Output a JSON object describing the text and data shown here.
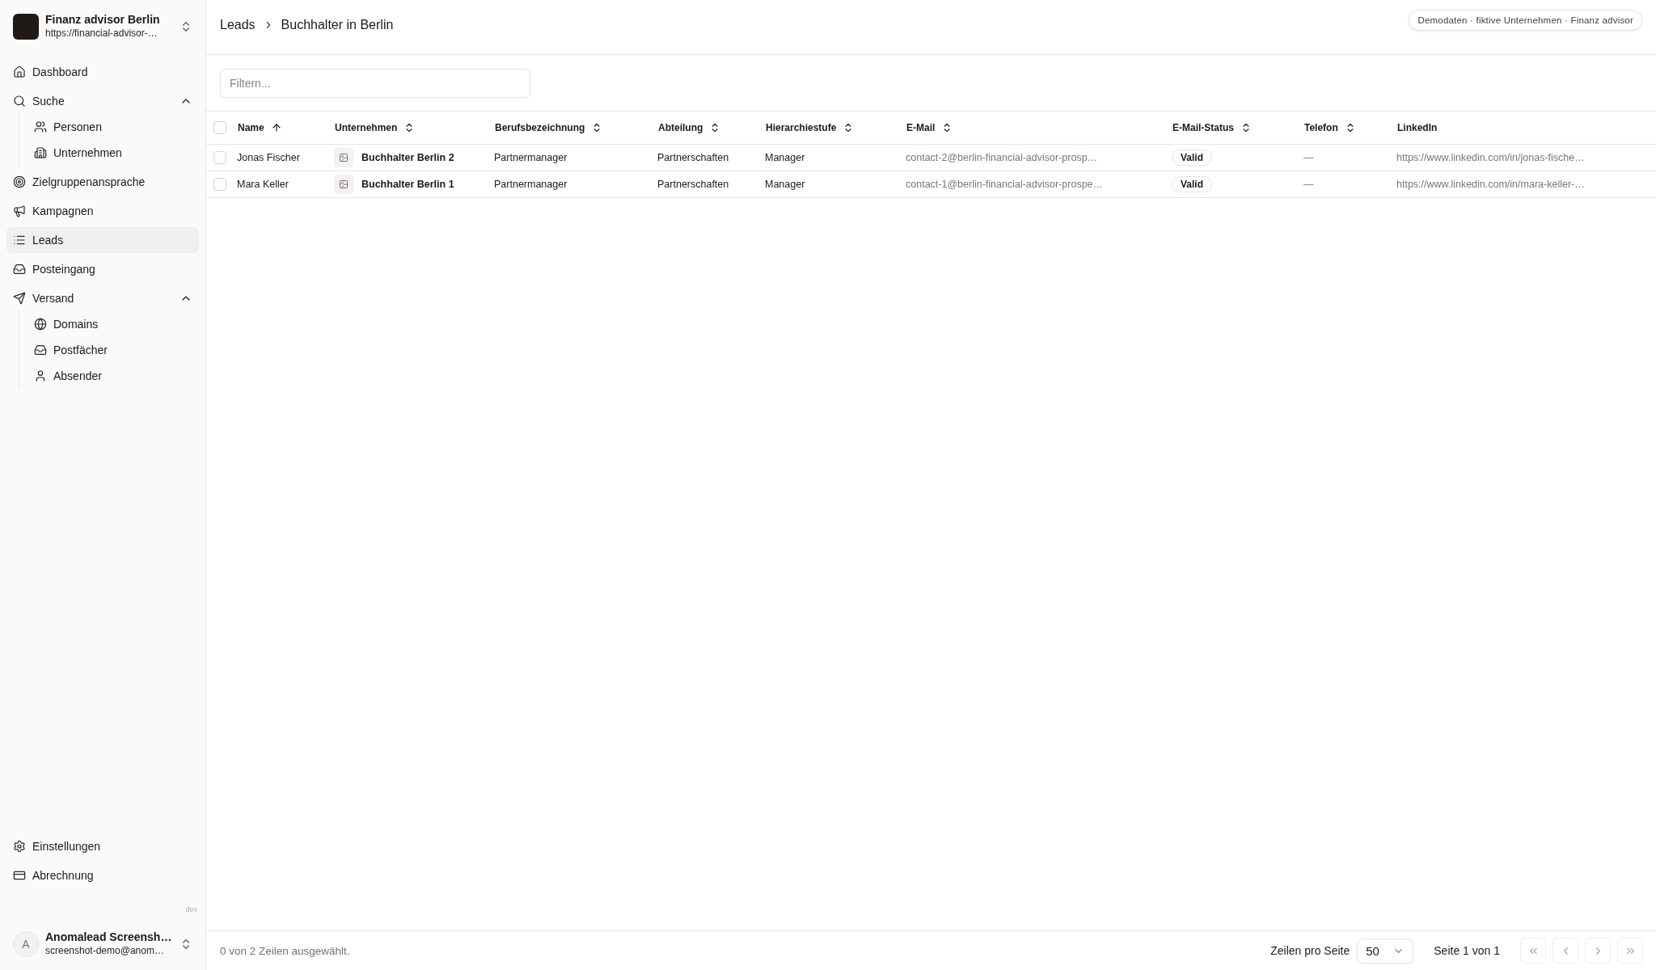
{
  "sidebar": {
    "workspace": {
      "name": "Finanz advisor Berlin",
      "url": "https://financial-advisor-…"
    },
    "nav": [
      {
        "label": "Dashboard",
        "selected": false
      },
      {
        "label": "Suche",
        "selected": false,
        "expanded": true,
        "children": [
          {
            "label": "Personen",
            "selected": false
          },
          {
            "label": "Unternehmen",
            "selected": false
          }
        ]
      },
      {
        "label": "Zielgruppenansprache",
        "selected": false
      },
      {
        "label": "Kampagnen",
        "selected": false
      },
      {
        "label": "Leads",
        "selected": true
      },
      {
        "label": "Posteingang",
        "selected": false
      },
      {
        "label": "Versand",
        "selected": false,
        "expanded": true,
        "children": [
          {
            "label": "Domains",
            "selected": false
          },
          {
            "label": "Postfächer",
            "selected": false
          },
          {
            "label": "Absender",
            "selected": false
          }
        ]
      }
    ],
    "bottom_nav": [
      {
        "label": "Einstellungen",
        "selected": false
      },
      {
        "label": "Abrechnung",
        "selected": false
      }
    ],
    "environment": "dev",
    "user": {
      "initial": "A",
      "name": "Anomalead Screensh…",
      "email": "screenshot-demo@anom…"
    }
  },
  "header": {
    "breadcrumb": [
      "Leads",
      "Buchhalter in Berlin"
    ],
    "badge": "Demodaten · fiktive Unternehmen · Finanz advisor"
  },
  "filter": {
    "placeholder": "Filtern..."
  },
  "table": {
    "select_all": {
      "checked": false
    },
    "columns": [
      {
        "label": "Name",
        "sorted": true
      },
      {
        "label": "Unternehmen",
        "sorted": false
      },
      {
        "label": "Berufsbezeichnung",
        "sorted": false
      },
      {
        "label": "Abteilung",
        "sorted": false
      },
      {
        "label": "Hierarchiestufe",
        "sorted": false
      },
      {
        "label": "E-Mail",
        "sorted": false
      },
      {
        "label": "E-Mail-Status",
        "sorted": false
      },
      {
        "label": "Telefon",
        "sorted": false
      },
      {
        "label": "LinkedIn"
      }
    ],
    "rows": [
      {
        "checked": false,
        "cells": [
          {
            "kind": "text",
            "text": "Jonas Fischer"
          },
          {
            "kind": "company",
            "text": "Buchhalter Berlin 2"
          },
          {
            "kind": "text",
            "text": "Partnermanager"
          },
          {
            "kind": "text",
            "text": "Partnerschaften"
          },
          {
            "kind": "text",
            "text": "Manager"
          },
          {
            "kind": "muted",
            "text": "contact-2@berlin-financial-advisor-prosp…"
          },
          {
            "kind": "badge",
            "text": "Valid"
          },
          {
            "kind": "muted",
            "text": "—"
          },
          {
            "kind": "muted",
            "text": "https://www.linkedin.com/in/jonas-fische…"
          }
        ]
      },
      {
        "checked": false,
        "cells": [
          {
            "kind": "text",
            "text": "Mara Keller"
          },
          {
            "kind": "company",
            "text": "Buchhalter Berlin 1"
          },
          {
            "kind": "text",
            "text": "Partnermanager"
          },
          {
            "kind": "text",
            "text": "Partnerschaften"
          },
          {
            "kind": "text",
            "text": "Manager"
          },
          {
            "kind": "muted",
            "text": "contact-1@berlin-financial-advisor-prospe…"
          },
          {
            "kind": "badge",
            "text": "Valid"
          },
          {
            "kind": "muted",
            "text": "—"
          },
          {
            "kind": "muted",
            "text": "https://www.linkedin.com/in/mara-keller-…"
          }
        ]
      }
    ]
  },
  "footer": {
    "selection": "0 von 2 Zeilen ausgewählt.",
    "rows_per_page_label": "Zeilen pro Seite",
    "rows_per_page": "50",
    "page": "Seite 1 von 1",
    "page_buttons": [
      {
        "disabled": true
      },
      {
        "disabled": true
      },
      {
        "disabled": true
      },
      {
        "disabled": true
      }
    ]
  }
}
